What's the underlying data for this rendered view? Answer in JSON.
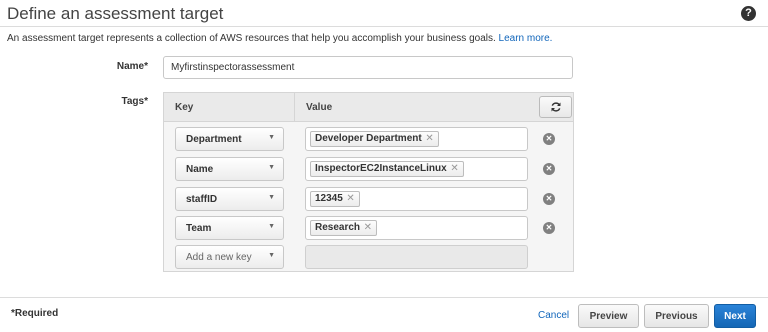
{
  "header": {
    "title": "Define an assessment target",
    "help_icon": "?"
  },
  "description": {
    "text": "An assessment target represents a collection of AWS resources that help you accomplish your business goals.",
    "link": "Learn more."
  },
  "form": {
    "name_label": "Name*",
    "name_value": "Myfirstinspectorassessment",
    "tags_label": "Tags*"
  },
  "tags_table": {
    "key_header": "Key",
    "value_header": "Value",
    "rows": [
      {
        "key": "Department",
        "value": "Developer Department"
      },
      {
        "key": "Name",
        "value": "InspectorEC2InstanceLinux"
      },
      {
        "key": "staffID",
        "value": "12345"
      },
      {
        "key": "Team",
        "value": "Research"
      }
    ],
    "new_key_placeholder": "Add a new key"
  },
  "footer": {
    "required": "*Required",
    "cancel": "Cancel",
    "preview": "Preview",
    "previous": "Previous",
    "next": "Next"
  },
  "colors": {
    "link": "#1166bb",
    "primary_button": "#1a73c8"
  },
  "icons": {
    "help": "question-circle-icon",
    "refresh": "refresh-icon",
    "caret": "caret-down-icon",
    "chip_remove": "x-icon",
    "row_remove": "remove-circle-icon"
  }
}
